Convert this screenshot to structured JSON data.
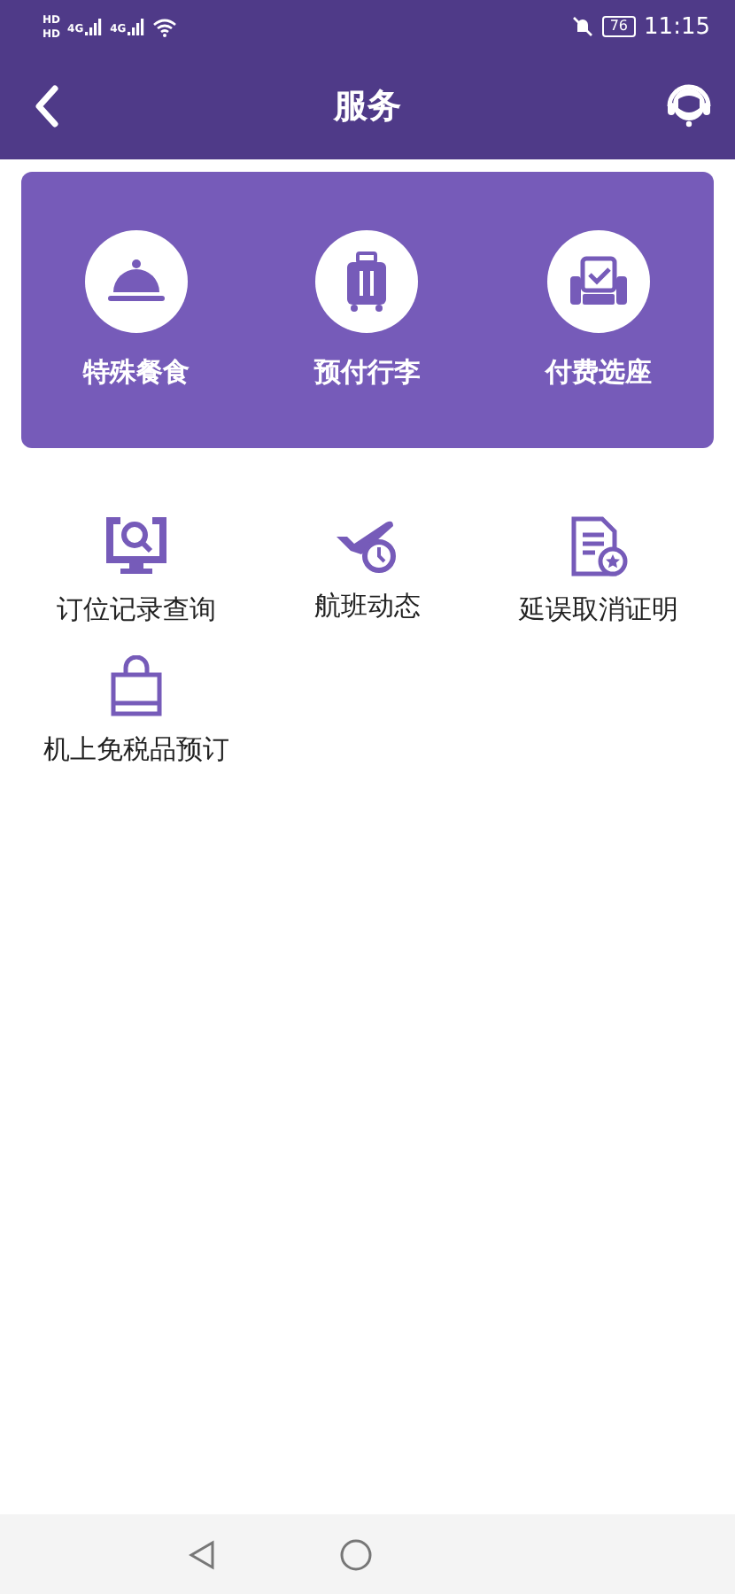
{
  "status_bar": {
    "sim_labels": [
      "HD",
      "HD"
    ],
    "network_labels": [
      "4G",
      "4G"
    ],
    "battery": "76",
    "time": "11:15"
  },
  "header": {
    "title": "服务"
  },
  "featured": [
    {
      "label": "特殊餐食"
    },
    {
      "label": "预付行李"
    },
    {
      "label": "付费选座"
    }
  ],
  "services": [
    {
      "label": "订位记录查询"
    },
    {
      "label": "航班动态"
    },
    {
      "label": "延误取消证明"
    },
    {
      "label": "机上免税品预订"
    }
  ]
}
